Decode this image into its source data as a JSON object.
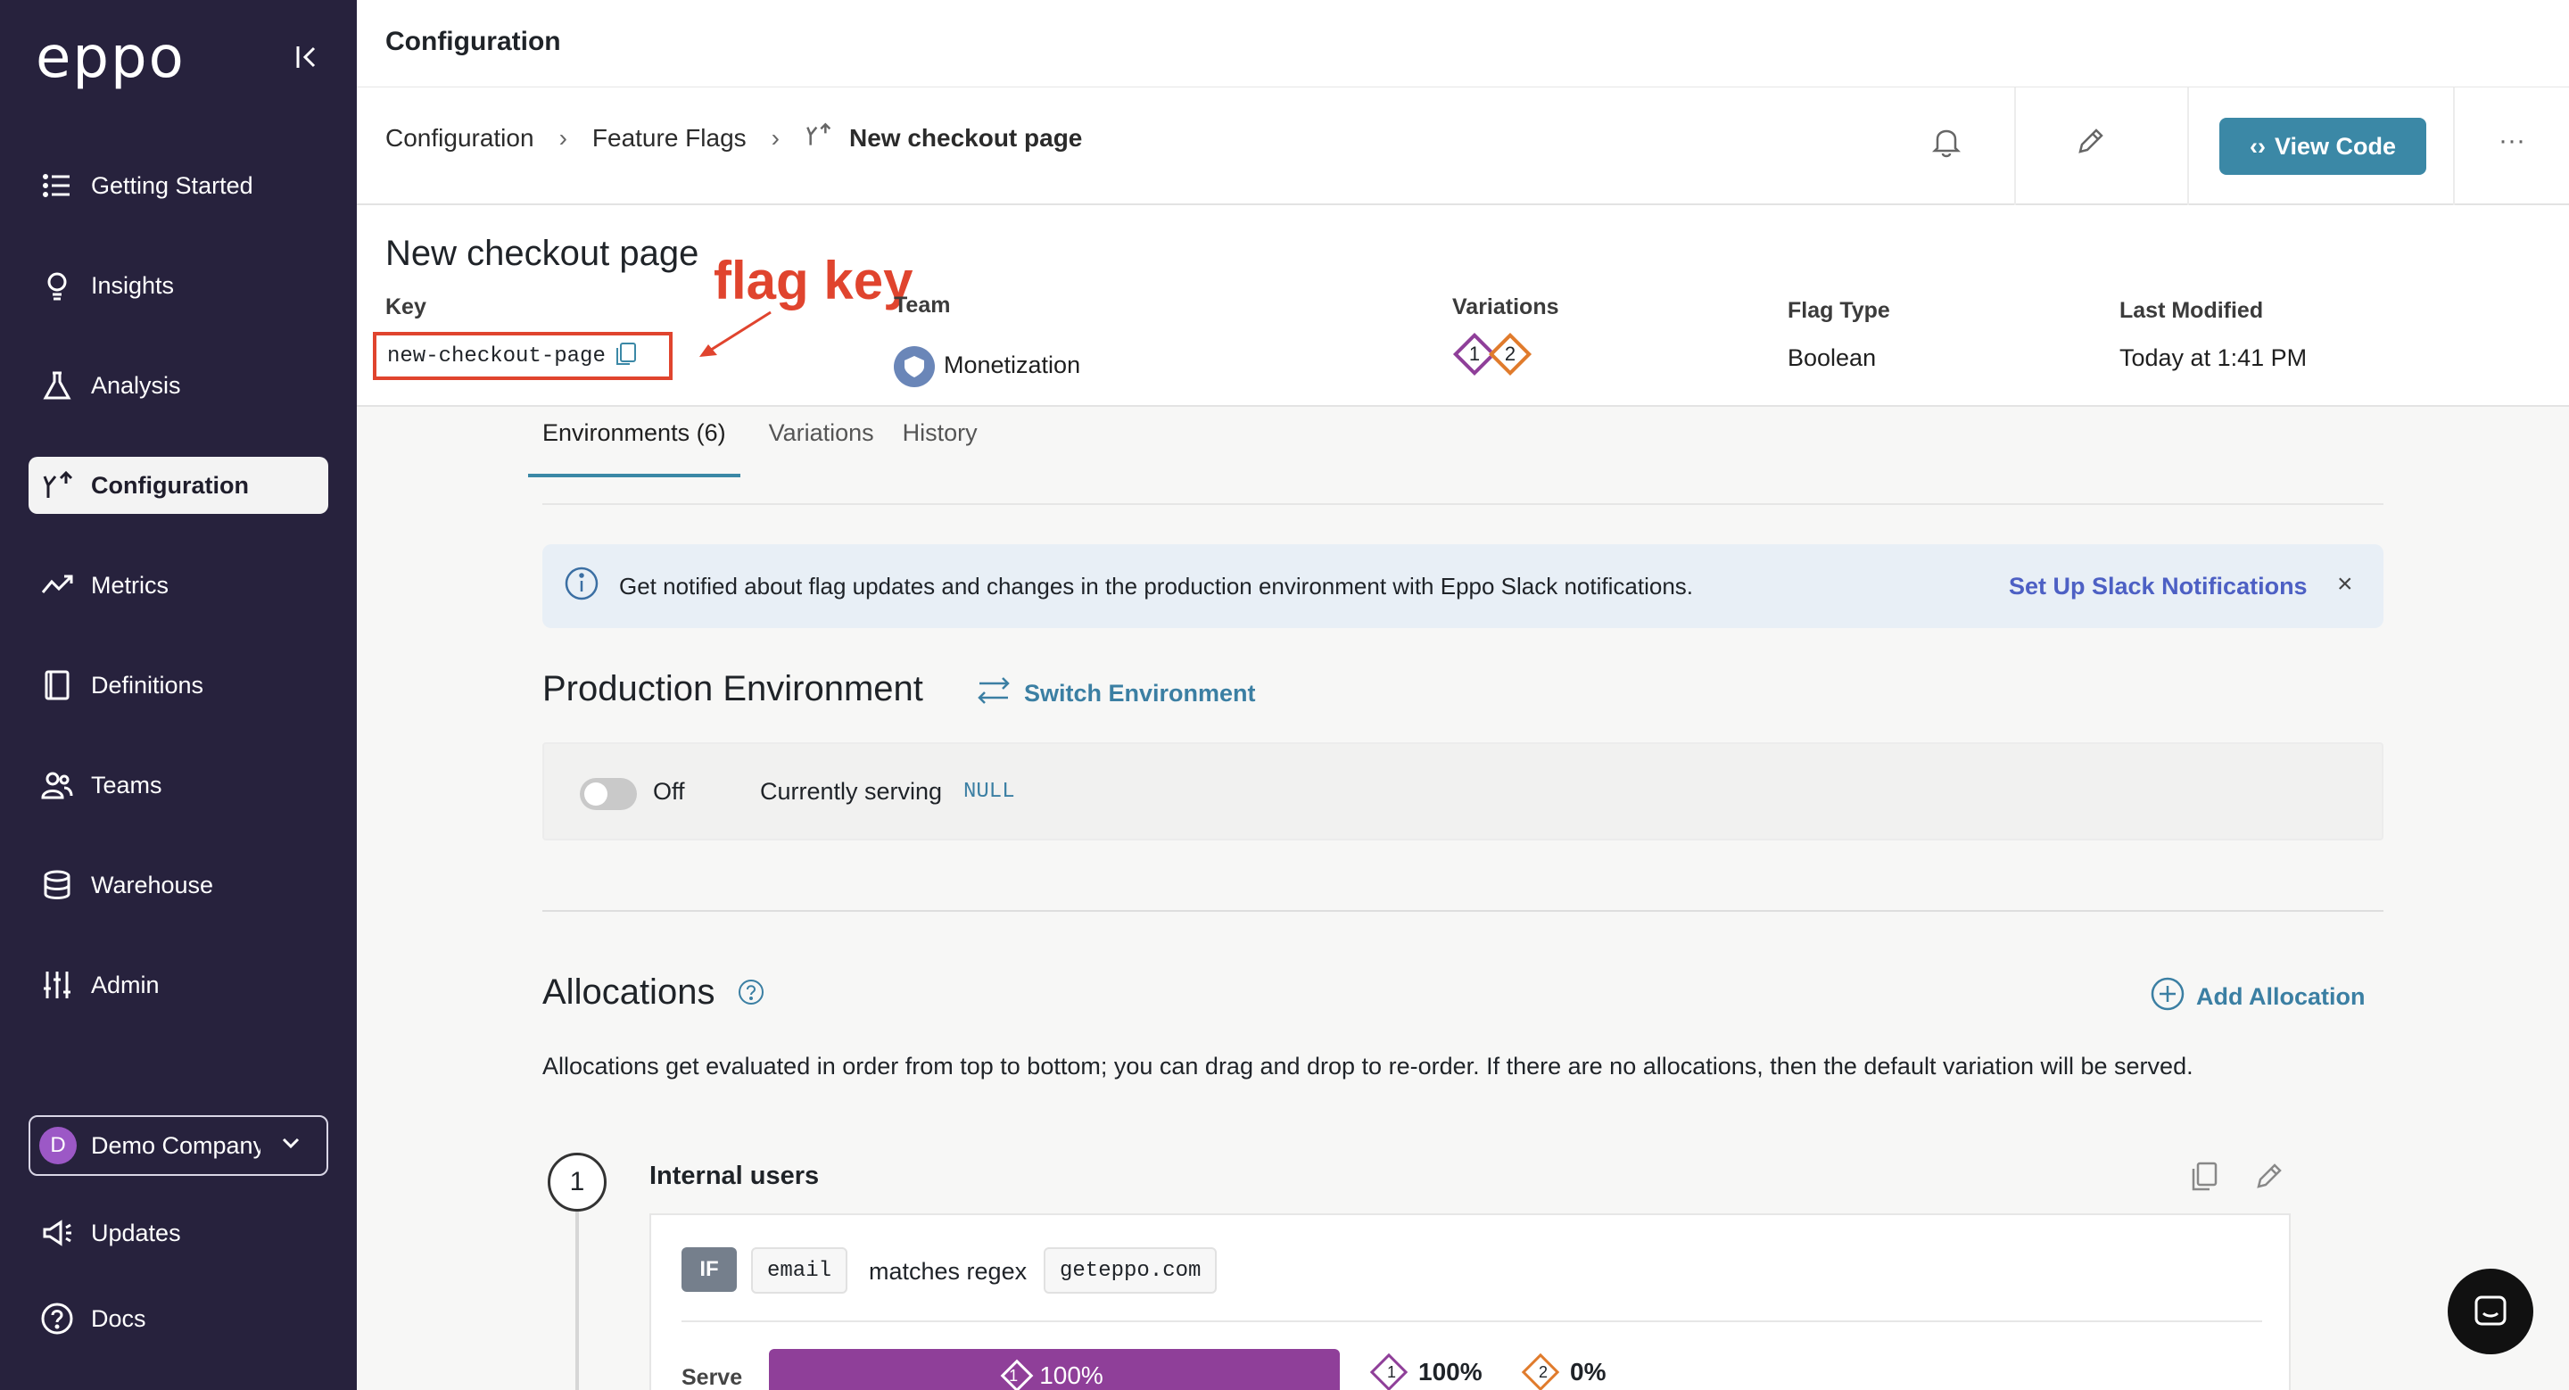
{
  "app": {
    "logo": "eppo"
  },
  "sidebar": {
    "items": [
      {
        "label": "Getting Started",
        "icon": "list-icon"
      },
      {
        "label": "Insights",
        "icon": "lightbulb-icon"
      },
      {
        "label": "Analysis",
        "icon": "flask-icon"
      },
      {
        "label": "Configuration",
        "icon": "flag-branch-icon",
        "active": true
      },
      {
        "label": "Metrics",
        "icon": "trend-icon"
      },
      {
        "label": "Definitions",
        "icon": "book-icon"
      },
      {
        "label": "Teams",
        "icon": "people-icon"
      },
      {
        "label": "Warehouse",
        "icon": "database-icon"
      },
      {
        "label": "Admin",
        "icon": "sliders-icon"
      }
    ],
    "company": {
      "initial": "D",
      "name": "Demo Company"
    },
    "bottom": [
      {
        "label": "Updates",
        "icon": "megaphone-icon"
      },
      {
        "label": "Docs",
        "icon": "help-icon"
      }
    ]
  },
  "header": {
    "title": "Configuration"
  },
  "breadcrumb": {
    "items": [
      "Configuration",
      "Feature Flags"
    ],
    "current": "New checkout page"
  },
  "toolbar": {
    "view_code": "View Code"
  },
  "flag": {
    "title": "New checkout page",
    "key_label": "Key",
    "key": "new-checkout-page",
    "annotation": "flag key",
    "team_label": "Team",
    "team": "Monetization",
    "variations_label": "Variations",
    "variation_ids": [
      "1",
      "2"
    ],
    "type_label": "Flag Type",
    "type": "Boolean",
    "modified_label": "Last Modified",
    "modified": "Today at 1:41 PM"
  },
  "tabs": [
    "Environments (6)",
    "Variations",
    "History"
  ],
  "banner": {
    "text": "Get notified about flag updates and changes in the production environment with Eppo Slack notifications.",
    "link": "Set Up Slack Notifications",
    "close": "×"
  },
  "environment": {
    "title": "Production Environment",
    "switch": "Switch Environment",
    "toggle_label": "Off",
    "serving_label": "Currently serving",
    "serving_value": "NULL"
  },
  "allocations": {
    "title": "Allocations",
    "add": "Add Allocation",
    "description": "Allocations get evaluated in order from top to bottom; you can drag and drop to re-order. If there are no allocations, then the default variation will be served.",
    "items": [
      {
        "order": "1",
        "name": "Internal users",
        "rule": {
          "if": "IF",
          "attribute": "email",
          "operator": "matches regex",
          "value": "geteppo.com"
        },
        "serve_label": "Serve",
        "serve_variation": "1",
        "serve_pct": "100%",
        "splits": [
          {
            "id": "1",
            "pct": "100%"
          },
          {
            "id": "2",
            "pct": "0%"
          }
        ]
      }
    ]
  },
  "colors": {
    "sidebar": "#27223d",
    "accent": "#3b88a6",
    "annotation": "#e0442e",
    "variation1": "#8f3f99",
    "variation2": "#e07b2c"
  }
}
